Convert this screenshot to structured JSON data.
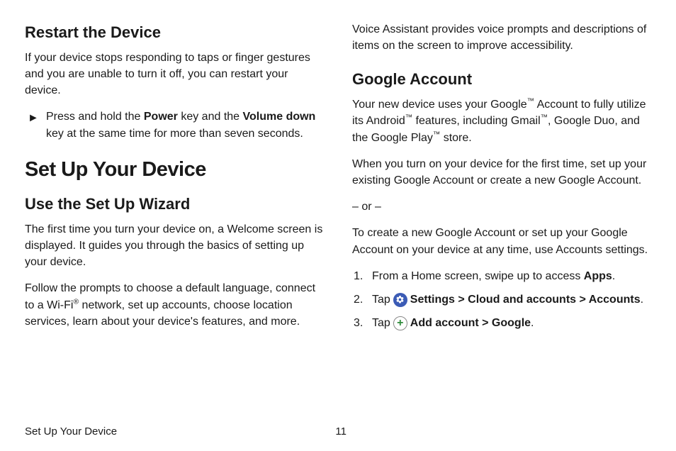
{
  "left": {
    "h_restart": "Restart the Device",
    "p_restart": "If your device stops responding to taps or finger gestures and you are unable to turn it off, you can restart your device.",
    "bullet_marker": "►",
    "bullet_pre": "Press and hold the ",
    "bullet_power": "Power",
    "bullet_mid": " key and the ",
    "bullet_voldown": "Volume down",
    "bullet_post": " key at the same time for more than seven seconds.",
    "h1_setup": "Set Up Your Device",
    "h_wizard": "Use the Set Up Wizard",
    "p_wizard1": "The first time you turn your device on, a Welcome screen is displayed. It guides you through the basics of setting up your device.",
    "p_wizard2_a": "Follow the prompts to choose a default language, connect to a Wi-Fi",
    "p_wizard2_b": " network, set up accounts, choose location services, learn about your device's features, and more.",
    "sup_r": "®"
  },
  "right": {
    "p_voice": "Voice Assistant provides voice prompts and descriptions of items on the screen to improve accessibility.",
    "h_google": "Google Account",
    "p_google1_a": "Your new device uses your Google",
    "p_google1_b": " Account to fully utilize its Android",
    "p_google1_c": " features, including Gmail",
    "p_google1_d": ", Google Duo, and the Google Play",
    "p_google1_e": " store.",
    "sup_tm": "™",
    "p_google2": "When you turn on your device for the first time, set up your existing Google Account or create a new Google Account.",
    "p_or": "– or –",
    "p_google3": "To create a new Google Account or set up your Google Account on your device at any time, use Accounts settings.",
    "steps": {
      "n1": "1.",
      "n2": "2.",
      "n3": "3.",
      "s1_a": "From a Home screen, swipe up to access ",
      "s1_apps": "Apps",
      "s1_dot": ".",
      "s2_tap": "Tap ",
      "s2_settings": "Settings",
      "gt": " > ",
      "s2_cloud": "Cloud and accounts",
      "s2_accounts": "Accounts",
      "s3_add": "Add account",
      "s3_google": "Google"
    },
    "plus_glyph": "+"
  },
  "footer": {
    "section": "Set Up Your Device",
    "page": "11"
  }
}
